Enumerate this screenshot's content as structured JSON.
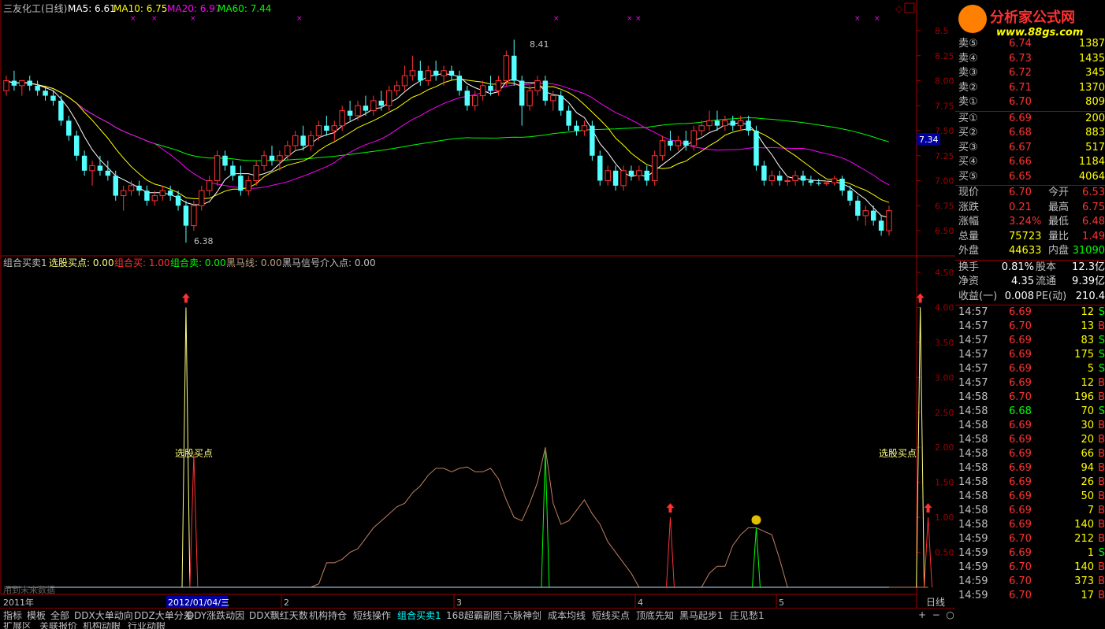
{
  "header": {
    "stock_name": "三友化工(日线)",
    "ma5": "MA5: 6.61",
    "ma10": "MA10: 6.75",
    "ma20": "MA20: 6.97",
    "ma60": "MA60: 7.44"
  },
  "indicator_header": {
    "name": "组合买卖1",
    "pick_label": "选股买点: 0.00",
    "buy_label": "组合买: 1.00",
    "sell_label": "组合卖: 0.00",
    "horse_label": "黑马线: 0.00",
    "signal_label": "黑马信号介入点: 0.00"
  },
  "price_axis": {
    "ticks": [
      "8.5",
      "8.25",
      "8.00",
      "7.75",
      "7.50",
      "7.25",
      "7.00",
      "6.75",
      "6.50"
    ],
    "current_value": "7.34"
  },
  "indicator_axis": {
    "ticks": [
      "4.50",
      "4.00",
      "3.50",
      "3.00",
      "2.50",
      "2.00",
      "1.50",
      "1.00",
      "0.50"
    ]
  },
  "annotations": {
    "high": "8.41",
    "low": "6.38",
    "pick_text_1": "选股买点",
    "pick_text_2": "选股买点",
    "watermark": "用到未来数据"
  },
  "time_axis": {
    "year": "2011年",
    "cursor_date": "2012/01/04/三",
    "months": [
      "2",
      "3",
      "4",
      "5"
    ],
    "period": "日线"
  },
  "logo": {
    "title": "分析家公式网",
    "url": "www.88gs.com"
  },
  "chart_data": {
    "type": "candlestick",
    "title": "三友化工(日线)",
    "ylim": [
      6.3,
      8.6
    ],
    "candles": [
      [
        7.9,
        8.05,
        7.85,
        8.0
      ],
      [
        8.0,
        8.1,
        7.9,
        7.95
      ],
      [
        7.95,
        8.0,
        7.85,
        8.0
      ],
      [
        8.0,
        8.05,
        7.9,
        7.95
      ],
      [
        7.95,
        8.0,
        7.85,
        7.9
      ],
      [
        7.9,
        7.95,
        7.8,
        7.85
      ],
      [
        7.85,
        7.9,
        7.75,
        7.8
      ],
      [
        7.8,
        7.85,
        7.55,
        7.6
      ],
      [
        7.6,
        7.65,
        7.4,
        7.45
      ],
      [
        7.45,
        7.5,
        7.2,
        7.25
      ],
      [
        7.25,
        7.3,
        7.05,
        7.1
      ],
      [
        7.1,
        7.2,
        6.95,
        7.15
      ],
      [
        7.15,
        7.25,
        7.05,
        7.1
      ],
      [
        7.1,
        7.2,
        7.0,
        7.05
      ],
      [
        7.05,
        7.1,
        6.8,
        6.85
      ],
      [
        6.85,
        6.95,
        6.7,
        6.9
      ],
      [
        6.9,
        7.0,
        6.85,
        6.95
      ],
      [
        6.95,
        7.0,
        6.85,
        6.9
      ],
      [
        6.9,
        6.95,
        6.75,
        6.8
      ],
      [
        6.8,
        6.9,
        6.75,
        6.85
      ],
      [
        6.85,
        6.95,
        6.8,
        6.9
      ],
      [
        6.9,
        6.95,
        6.8,
        6.85
      ],
      [
        6.85,
        6.9,
        6.7,
        6.75
      ],
      [
        6.75,
        6.8,
        6.38,
        6.55
      ],
      [
        6.55,
        6.8,
        6.5,
        6.75
      ],
      [
        6.75,
        6.95,
        6.7,
        6.9
      ],
      [
        6.9,
        7.05,
        6.85,
        7.0
      ],
      [
        7.0,
        7.3,
        6.95,
        7.25
      ],
      [
        7.25,
        7.3,
        7.1,
        7.15
      ],
      [
        7.15,
        7.2,
        7.0,
        7.05
      ],
      [
        7.05,
        7.15,
        6.85,
        6.9
      ],
      [
        6.9,
        7.05,
        6.85,
        7.0
      ],
      [
        7.0,
        7.2,
        6.95,
        7.15
      ],
      [
        7.15,
        7.3,
        7.1,
        7.25
      ],
      [
        7.25,
        7.35,
        7.15,
        7.2
      ],
      [
        7.2,
        7.3,
        7.1,
        7.25
      ],
      [
        7.25,
        7.4,
        7.2,
        7.35
      ],
      [
        7.35,
        7.5,
        7.3,
        7.45
      ],
      [
        7.45,
        7.55,
        7.3,
        7.35
      ],
      [
        7.35,
        7.5,
        7.3,
        7.45
      ],
      [
        7.45,
        7.6,
        7.4,
        7.55
      ],
      [
        7.55,
        7.65,
        7.45,
        7.5
      ],
      [
        7.5,
        7.6,
        7.4,
        7.55
      ],
      [
        7.55,
        7.75,
        7.5,
        7.7
      ],
      [
        7.7,
        7.8,
        7.6,
        7.65
      ],
      [
        7.65,
        7.8,
        7.6,
        7.75
      ],
      [
        7.75,
        7.85,
        7.65,
        7.7
      ],
      [
        7.7,
        7.85,
        7.65,
        7.8
      ],
      [
        7.8,
        7.9,
        7.7,
        7.75
      ],
      [
        7.75,
        7.95,
        7.7,
        7.9
      ],
      [
        7.9,
        8.0,
        7.85,
        7.95
      ],
      [
        7.95,
        8.15,
        7.9,
        8.05
      ],
      [
        8.05,
        8.25,
        8.0,
        8.1
      ],
      [
        8.1,
        8.2,
        7.95,
        8.0
      ],
      [
        8.0,
        8.15,
        7.95,
        8.1
      ],
      [
        8.1,
        8.2,
        8.0,
        8.05
      ],
      [
        8.05,
        8.15,
        7.95,
        8.1
      ],
      [
        8.1,
        8.15,
        8.0,
        8.05
      ],
      [
        8.05,
        8.1,
        7.85,
        7.9
      ],
      [
        7.9,
        7.95,
        7.7,
        7.75
      ],
      [
        7.75,
        7.9,
        7.7,
        7.85
      ],
      [
        7.85,
        8.0,
        7.8,
        7.95
      ],
      [
        7.95,
        8.05,
        7.85,
        7.9
      ],
      [
        7.9,
        8.05,
        7.85,
        8.0
      ],
      [
        8.0,
        8.3,
        7.95,
        8.25
      ],
      [
        8.25,
        8.41,
        7.95,
        8.0
      ],
      [
        8.0,
        8.05,
        7.55,
        7.75
      ],
      [
        7.75,
        7.95,
        7.7,
        7.9
      ],
      [
        7.9,
        8.05,
        7.85,
        8.0
      ],
      [
        8.0,
        8.05,
        7.75,
        7.8
      ],
      [
        7.8,
        7.9,
        7.7,
        7.85
      ],
      [
        7.85,
        7.9,
        7.65,
        7.7
      ],
      [
        7.7,
        7.75,
        7.5,
        7.55
      ],
      [
        7.55,
        7.6,
        7.45,
        7.5
      ],
      [
        7.5,
        7.6,
        7.45,
        7.55
      ],
      [
        7.55,
        7.6,
        7.2,
        7.25
      ],
      [
        7.25,
        7.3,
        6.95,
        7.0
      ],
      [
        7.0,
        7.15,
        6.95,
        7.1
      ],
      [
        7.1,
        7.15,
        6.9,
        6.95
      ],
      [
        6.95,
        7.15,
        6.9,
        7.1
      ],
      [
        7.1,
        7.15,
        7.0,
        7.05
      ],
      [
        7.05,
        7.15,
        7.0,
        7.1
      ],
      [
        7.1,
        7.15,
        6.95,
        7.0
      ],
      [
        7.0,
        7.3,
        6.95,
        7.25
      ],
      [
        7.25,
        7.45,
        7.2,
        7.4
      ],
      [
        7.4,
        7.5,
        7.3,
        7.35
      ],
      [
        7.35,
        7.45,
        7.3,
        7.4
      ],
      [
        7.4,
        7.5,
        7.3,
        7.35
      ],
      [
        7.35,
        7.55,
        7.3,
        7.5
      ],
      [
        7.5,
        7.6,
        7.45,
        7.55
      ],
      [
        7.55,
        7.7,
        7.5,
        7.6
      ],
      [
        7.6,
        7.7,
        7.5,
        7.55
      ],
      [
        7.55,
        7.65,
        7.5,
        7.6
      ],
      [
        7.6,
        7.65,
        7.5,
        7.55
      ],
      [
        7.55,
        7.65,
        7.5,
        7.6
      ],
      [
        7.6,
        7.65,
        7.45,
        7.5
      ],
      [
        7.5,
        7.55,
        7.1,
        7.15
      ],
      [
        7.15,
        7.2,
        6.95,
        7.0
      ],
      [
        7.0,
        7.1,
        6.95,
        7.05
      ],
      [
        7.05,
        7.1,
        6.95,
        7.0
      ],
      [
        7.0,
        7.05,
        6.95,
        7.0
      ],
      [
        7.0,
        7.1,
        6.95,
        7.05
      ],
      [
        7.05,
        7.1,
        6.95,
        7.0
      ],
      [
        7.0,
        7.05,
        6.95,
        6.98
      ],
      [
        6.98,
        7.02,
        6.95,
        6.97
      ],
      [
        6.97,
        7.0,
        6.95,
        6.98
      ],
      [
        6.98,
        7.05,
        6.95,
        7.02
      ],
      [
        7.02,
        7.05,
        6.85,
        6.9
      ],
      [
        6.9,
        6.95,
        6.75,
        6.8
      ],
      [
        6.8,
        6.85,
        6.6,
        6.65
      ],
      [
        6.65,
        6.75,
        6.55,
        6.7
      ],
      [
        6.7,
        6.75,
        6.55,
        6.6
      ],
      [
        6.6,
        6.65,
        6.45,
        6.5
      ],
      [
        6.5,
        6.75,
        6.45,
        6.7
      ]
    ],
    "indicator": {
      "pick_spikes": [
        {
          "index": 23,
          "value": 4.0
        },
        {
          "index": 117,
          "value": 4.0
        }
      ],
      "buy_spikes": [
        {
          "index": 24,
          "value": 1.9
        },
        {
          "index": 85,
          "value": 1.0
        },
        {
          "index": 118,
          "value": 1.0
        }
      ],
      "sell_spikes": [
        {
          "index": 69,
          "value": 1.95
        },
        {
          "index": 96,
          "value": 0.85
        }
      ],
      "horse_line": [
        0,
        0,
        0,
        0,
        0,
        0,
        0,
        0,
        0,
        0,
        0,
        0,
        0,
        0,
        0,
        0,
        0,
        0,
        0,
        0,
        0,
        0,
        0,
        0,
        0,
        0,
        0,
        0,
        0,
        0,
        0,
        0,
        0,
        0,
        0,
        0,
        0,
        0,
        0,
        0,
        0.05,
        0.35,
        0.35,
        0.4,
        0.5,
        0.55,
        0.7,
        0.85,
        0.95,
        1.05,
        1.15,
        1.2,
        1.35,
        1.45,
        1.6,
        1.7,
        1.7,
        1.65,
        1.7,
        1.72,
        1.65,
        1.65,
        1.7,
        1.55,
        1.25,
        1.0,
        0.95,
        1.2,
        1.5,
        2.0,
        1.2,
        0.9,
        0.95,
        1.1,
        1.25,
        1.05,
        0.9,
        0.65,
        0.5,
        0.35,
        0.2,
        0,
        0,
        0,
        0,
        0,
        0,
        0,
        0,
        0,
        0.2,
        0.3,
        0.3,
        0.6,
        0.75,
        0.85,
        0.85,
        0.8,
        0.75,
        0.4,
        0,
        0,
        0,
        0,
        0,
        0,
        0,
        0,
        0,
        0,
        0,
        0,
        0,
        0,
        0,
        0,
        0,
        0,
        0
      ]
    }
  },
  "quote": {
    "rows": [
      {
        "label": "卖⑤",
        "price": "6.74",
        "vol": "1387"
      },
      {
        "label": "卖④",
        "price": "6.73",
        "vol": "1435"
      },
      {
        "label": "卖③",
        "price": "6.72",
        "vol": "345"
      },
      {
        "label": "卖②",
        "price": "6.71",
        "vol": "1370"
      },
      {
        "label": "卖①",
        "price": "6.70",
        "vol": "809"
      },
      {
        "label": "买①",
        "price": "6.69",
        "vol": "200"
      },
      {
        "label": "买②",
        "price": "6.68",
        "vol": "883"
      },
      {
        "label": "买③",
        "price": "6.67",
        "vol": "517"
      },
      {
        "label": "买④",
        "price": "6.66",
        "vol": "1184"
      },
      {
        "label": "买⑤",
        "price": "6.65",
        "vol": "4064"
      }
    ],
    "stats": [
      {
        "l1": "现价",
        "v1": "6.70",
        "l2": "今开",
        "v2": "6.53"
      },
      {
        "l1": "涨跌",
        "v1": "0.21",
        "l2": "最高",
        "v2": "6.75"
      },
      {
        "l1": "涨幅",
        "v1": "3.24%",
        "l2": "最低",
        "v2": "6.48"
      },
      {
        "l1": "总量",
        "v1": "75723",
        "l2": "量比",
        "v2": "1.49"
      },
      {
        "l1": "外盘",
        "v1": "44633",
        "l2": "内盘",
        "v2": "31090"
      }
    ],
    "info": [
      {
        "l1": "换手",
        "v1": "0.81%",
        "l2": "股本",
        "v2": "12.3亿"
      },
      {
        "l1": "净资",
        "v1": "4.35",
        "l2": "流通",
        "v2": "9.39亿"
      },
      {
        "l1": "收益(一)",
        "v1": "0.008",
        "l2": "PE(动)",
        "v2": "210.4"
      }
    ],
    "ticks": [
      {
        "t": "14:57",
        "p": "6.69",
        "v": "12",
        "s": "S"
      },
      {
        "t": "14:57",
        "p": "6.70",
        "v": "13",
        "s": "B"
      },
      {
        "t": "14:57",
        "p": "6.69",
        "v": "83",
        "s": "S"
      },
      {
        "t": "14:57",
        "p": "6.69",
        "v": "175",
        "s": "S"
      },
      {
        "t": "14:57",
        "p": "6.69",
        "v": "5",
        "s": "S"
      },
      {
        "t": "14:57",
        "p": "6.69",
        "v": "12",
        "s": "B"
      },
      {
        "t": "14:58",
        "p": "6.70",
        "v": "196",
        "s": "B"
      },
      {
        "t": "14:58",
        "p": "6.68",
        "v": "70",
        "s": "S"
      },
      {
        "t": "14:58",
        "p": "6.69",
        "v": "30",
        "s": "B"
      },
      {
        "t": "14:58",
        "p": "6.69",
        "v": "20",
        "s": "B"
      },
      {
        "t": "14:58",
        "p": "6.69",
        "v": "66",
        "s": "B"
      },
      {
        "t": "14:58",
        "p": "6.69",
        "v": "94",
        "s": "B"
      },
      {
        "t": "14:58",
        "p": "6.69",
        "v": "26",
        "s": "B"
      },
      {
        "t": "14:58",
        "p": "6.69",
        "v": "50",
        "s": "B"
      },
      {
        "t": "14:58",
        "p": "6.69",
        "v": "7",
        "s": "B"
      },
      {
        "t": "14:58",
        "p": "6.69",
        "v": "140",
        "s": "B"
      },
      {
        "t": "14:59",
        "p": "6.70",
        "v": "212",
        "s": "B"
      },
      {
        "t": "14:59",
        "p": "6.69",
        "v": "1",
        "s": "S"
      },
      {
        "t": "14:59",
        "p": "6.70",
        "v": "140",
        "s": "B"
      },
      {
        "t": "14:59",
        "p": "6.70",
        "v": "373",
        "s": "B"
      },
      {
        "t": "14:59",
        "p": "6.70",
        "v": "17",
        "s": "B"
      }
    ]
  },
  "tabs": [
    "指标",
    "模板",
    "全部",
    "DDX大单动向",
    "DDZ大单分差",
    "DDY涨跌动因",
    "DDX飘红天数",
    "机构持仓",
    "短线操作",
    "组合买卖1",
    "168超霸副图",
    "六脉神剑",
    "成本均线",
    "短线买点",
    "顶底先知",
    "黑马起步1",
    "庄见愁1"
  ],
  "bottom_tabs": [
    "扩展区",
    "关联报价",
    "机构动眼",
    "行业动眼"
  ],
  "colors": {
    "up": "#ff3232",
    "down": "#54ffff",
    "ma5": "#ffffff",
    "ma10": "#ffff00",
    "ma20": "#ff00ff",
    "ma60": "#00ff00",
    "border": "#a00000"
  }
}
